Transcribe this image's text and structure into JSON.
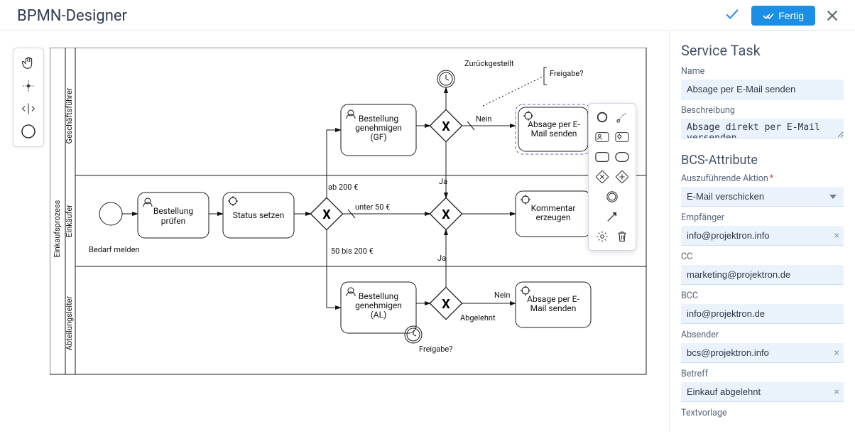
{
  "header": {
    "title": "BPMN-Designer",
    "done_label": "Fertig"
  },
  "panel": {
    "title": "Service Task",
    "name_label": "Name",
    "name_value": "Absage per E-Mail senden",
    "desc_label": "Beschreibung",
    "desc_value": "Absage direkt per E-Mail versenden",
    "attr_title": "BCS-Attribute",
    "action_label": "Auszuführende Aktion",
    "action_value": "E-Mail verschicken",
    "recipient_label": "Empfänger",
    "recipient_value": "info@projektron.info",
    "cc_label": "CC",
    "cc_value": "marketing@projektron.de",
    "bcc_label": "BCC",
    "bcc_value": "info@projektron.de",
    "sender_label": "Absender",
    "sender_value": "bcs@projektron.info",
    "subject_label": "Betreff",
    "subject_value": "Einkauf abgelehnt",
    "template_label": "Textvorlage"
  },
  "diagram": {
    "pool": "Einkaufsprozess",
    "lanes": [
      "Geschäftsführer",
      "Einkäufer",
      "Abteilungsleiter"
    ],
    "start_label": "Bedarf melden",
    "tasks": {
      "bestellung_pruefen": "Bestellung prüfen",
      "status_setzen": "Status setzen",
      "bestellung_genehmigen_gf": "Bestellung genehmigen (GF)",
      "bestellung_genehmigen_al": "Bestellung genehmigen (AL)",
      "absage_senden_gf": "Absage per E-Mail senden",
      "absage_senden_al": "Absage per E-Mail senden",
      "kommentar_erzeugen": "Kommentar erzeugen"
    },
    "edges": {
      "ab_200": "ab 200 €",
      "unter_50": "unter 50 €",
      "fuenfzig_200": "50 bis 200 €",
      "ja": "Ja",
      "nein": "Nein",
      "zurueckgestellt": "Zurückgestellt",
      "abgelehnt": "Abgelehnt",
      "freigabe": "Freigabe?"
    }
  }
}
